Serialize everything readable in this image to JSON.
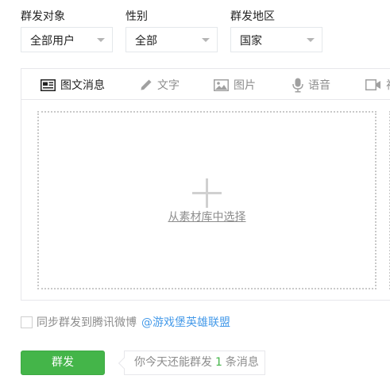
{
  "filters": [
    {
      "label": "群发对象",
      "value": "全部用户"
    },
    {
      "label": "性别",
      "value": "全部"
    },
    {
      "label": "群发地区",
      "value": "国家"
    }
  ],
  "tabs": [
    {
      "label": "图文消息",
      "icon": "news-icon",
      "active": true
    },
    {
      "label": "文字",
      "icon": "pencil-icon",
      "active": false
    },
    {
      "label": "图片",
      "icon": "image-icon",
      "active": false
    },
    {
      "label": "语音",
      "icon": "microphone-icon",
      "active": false
    },
    {
      "label": "视",
      "icon": "video-icon",
      "active": false
    }
  ],
  "editor": {
    "pick_label": "从素材库中选择"
  },
  "sync": {
    "label": "同步群发到腾讯微博",
    "account": "@游戏堡英雄联盟",
    "checked": false
  },
  "send": {
    "button_label": "群发",
    "tip_prefix": "你今天还能群发",
    "tip_count": "1",
    "tip_suffix": "条消息"
  },
  "colors": {
    "accent_green": "#44b549",
    "link_blue": "#459ae9",
    "muted_text": "#8d8d8d",
    "border": "#e7e7eb"
  }
}
